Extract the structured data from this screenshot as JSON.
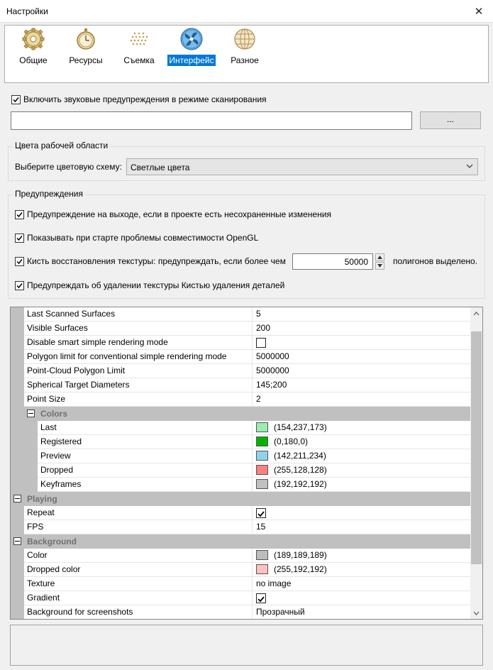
{
  "window": {
    "title": "Настройки",
    "close_glyph": "✕"
  },
  "tabs": [
    {
      "label": "Общие",
      "icon": "gear-icon"
    },
    {
      "label": "Ресурсы",
      "icon": "stopwatch-icon"
    },
    {
      "label": "Съемка",
      "icon": "dot-matrix-icon"
    },
    {
      "label": "Интерфейс",
      "icon": "fan-icon",
      "active": true
    },
    {
      "label": "Разное",
      "icon": "globe-icon"
    }
  ],
  "sound": {
    "checked": true,
    "label": "Включить звуковые предупреждения в режиме сканирования",
    "path_value": "",
    "browse_label": "..."
  },
  "workspace_colors": {
    "group_title": "Цвета рабочей области",
    "scheme_label": "Выберите цветовую схему:",
    "scheme_value": "Светлые цвета"
  },
  "warnings": {
    "group_title": "Предупреждения",
    "items": [
      {
        "checked": true,
        "label": "Предупреждение на выходе, если в проекте есть несохраненные изменения"
      },
      {
        "checked": true,
        "label": "Показывать при старте проблемы совместимости OpenGL"
      },
      {
        "checked": true,
        "label": "Кисть восстановления текстуры: предупреждать, если более чем"
      },
      {
        "checked": true,
        "label": "Предупреждать об удалении текстуры Кистью удаления деталей"
      }
    ],
    "polygon_threshold": "50000",
    "polygon_suffix": "полигонов выделено."
  },
  "grid": {
    "rows": [
      {
        "kind": "prop",
        "indent": 1,
        "name": "Last Scanned Surfaces",
        "value": "5"
      },
      {
        "kind": "prop",
        "indent": 1,
        "name": "Visible Surfaces",
        "value": "200"
      },
      {
        "kind": "prop",
        "indent": 1,
        "name": "Disable smart simple rendering mode",
        "checkbox": false
      },
      {
        "kind": "prop",
        "indent": 1,
        "name": "Polygon limit for conventional simple rendering mode",
        "value": "5000000"
      },
      {
        "kind": "prop",
        "indent": 1,
        "name": "Point-Cloud Polygon Limit",
        "value": "5000000"
      },
      {
        "kind": "prop",
        "indent": 1,
        "name": "Spherical Target Diameters",
        "value": "145;200"
      },
      {
        "kind": "prop",
        "indent": 1,
        "name": "Point Size",
        "value": "2"
      },
      {
        "kind": "cat",
        "indent": 1,
        "name": "Colors"
      },
      {
        "kind": "prop",
        "indent": 2,
        "name": "Last",
        "color": "#9aedad",
        "value": "(154,237,173)"
      },
      {
        "kind": "prop",
        "indent": 2,
        "name": "Registered",
        "color": "#00b400",
        "value": "(0,180,0)"
      },
      {
        "kind": "prop",
        "indent": 2,
        "name": "Preview",
        "color": "#8ed3ea",
        "value": "(142,211,234)"
      },
      {
        "kind": "prop",
        "indent": 2,
        "name": "Dropped",
        "color": "#ff8080",
        "value": "(255,128,128)"
      },
      {
        "kind": "prop",
        "indent": 2,
        "name": "Keyframes",
        "color": "#c0c0c0",
        "value": "(192,192,192)"
      },
      {
        "kind": "cat",
        "indent": 0,
        "name": "Playing"
      },
      {
        "kind": "prop",
        "indent": 1,
        "name": "Repeat",
        "checkbox": true
      },
      {
        "kind": "prop",
        "indent": 1,
        "name": "FPS",
        "value": "15"
      },
      {
        "kind": "cat",
        "indent": 0,
        "name": "Background"
      },
      {
        "kind": "prop",
        "indent": 1,
        "name": "Color",
        "color": "#bdbdbd",
        "value": "(189,189,189)"
      },
      {
        "kind": "prop",
        "indent": 1,
        "name": "Dropped color",
        "color": "#ffc0c0",
        "value": "(255,192,192)"
      },
      {
        "kind": "prop",
        "indent": 1,
        "name": "Texture",
        "value": "no image"
      },
      {
        "kind": "prop",
        "indent": 1,
        "name": "Gradient",
        "checkbox": true
      },
      {
        "kind": "prop",
        "indent": 1,
        "name": "Background for screenshots",
        "value": "Прозрачный"
      }
    ]
  },
  "description": {
    "text": ""
  }
}
